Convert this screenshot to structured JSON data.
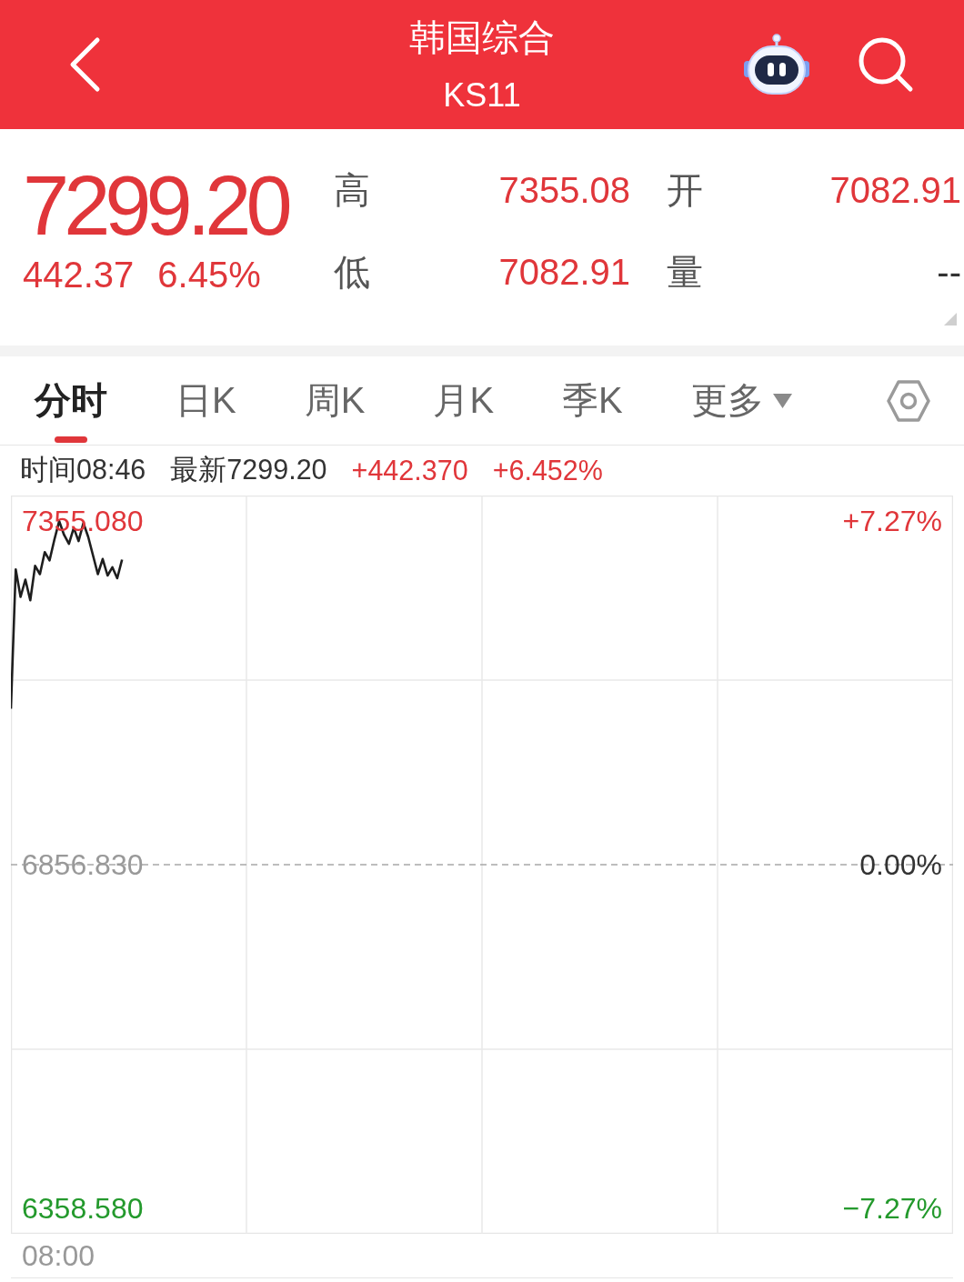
{
  "header": {
    "title": "韩国综合",
    "subtitle": "KS11"
  },
  "quote": {
    "price": "7299.20",
    "change": "442.37",
    "change_percent": "6.45%",
    "stats": [
      {
        "label": "高",
        "value": "7355.08",
        "color": "#e0363a"
      },
      {
        "label": "开",
        "value": "7082.91",
        "color": "#e0363a"
      },
      {
        "label": "低",
        "value": "7082.91",
        "color": "#e0363a"
      },
      {
        "label": "量",
        "value": "--",
        "color": "#333333"
      }
    ]
  },
  "tabs": [
    {
      "label": "分时",
      "selected": true,
      "kind": "tab"
    },
    {
      "label": "日K",
      "selected": false,
      "kind": "tab"
    },
    {
      "label": "周K",
      "selected": false,
      "kind": "tab"
    },
    {
      "label": "月K",
      "selected": false,
      "kind": "tab"
    },
    {
      "label": "季K",
      "selected": false,
      "kind": "tab"
    },
    {
      "label": "更多",
      "selected": false,
      "kind": "menu"
    }
  ],
  "info_bar": {
    "time": "时间08:46",
    "latest": "最新7299.20",
    "change": "+442.370",
    "change_percent": "+6.452%"
  },
  "chart": {
    "percent_labels": [
      {
        "text": "+7.27%",
        "color": "#e0363a"
      },
      {
        "text": "0.00%",
        "color": "#333333"
      },
      {
        "text": "−7.27%",
        "color": "#23992c"
      }
    ],
    "time_label": "08:00",
    "chart_data": {
      "type": "line",
      "categories": [
        null,
        null,
        null,
        null,
        null,
        null,
        null,
        null,
        null,
        null,
        null,
        null,
        null,
        null,
        null,
        null,
        null,
        null,
        null,
        null,
        null,
        null,
        null,
        null,
        null,
        null,
        null,
        null,
        null,
        null,
        null,
        null,
        null,
        null,
        null,
        null,
        null,
        null,
        null,
        null,
        null,
        null,
        null,
        null,
        null,
        null,
        null,
        null,
        null,
        null,
        null,
        null,
        null,
        null,
        null,
        null,
        null,
        null,
        null,
        null,
        null,
        null,
        null,
        null,
        null,
        null,
        null,
        null,
        null,
        null,
        null,
        null,
        null,
        null,
        null,
        null,
        null,
        null,
        null,
        null,
        null,
        null,
        null,
        null,
        null,
        null,
        null,
        null,
        null,
        null,
        null,
        null,
        null,
        null,
        null,
        null,
        null,
        null,
        null,
        null,
        null,
        null,
        null,
        null,
        null,
        null,
        null,
        null,
        null,
        null,
        null,
        null,
        null,
        null,
        null,
        null,
        null,
        null,
        null,
        null,
        null,
        null,
        null,
        null,
        null,
        null,
        null,
        null,
        null,
        null,
        null,
        null,
        null,
        null,
        null,
        null,
        null,
        null,
        null,
        null,
        null,
        null,
        null,
        null,
        null,
        null,
        null,
        null,
        null,
        null,
        null,
        null,
        null,
        null,
        null,
        null,
        null,
        null,
        null,
        null,
        null,
        null,
        null,
        null,
        null,
        null,
        null,
        null,
        null,
        null,
        null,
        null,
        null,
        null,
        null,
        null,
        null,
        null,
        null,
        null,
        null,
        null,
        null,
        null,
        null,
        null,
        null,
        null,
        null,
        null,
        null,
        null,
        null,
        null,
        null,
        null
      ],
      "values": [
        7083,
        7285,
        7245,
        7270,
        7240,
        7290,
        7278,
        7310,
        7298,
        7328,
        7355,
        7335,
        7322,
        7345,
        7326,
        7352,
        7332,
        7305,
        7278,
        7300,
        7276,
        7288,
        7272,
        7299,
        null,
        null,
        null,
        null,
        null,
        null,
        null,
        null,
        null,
        null,
        null,
        null,
        null,
        null,
        null,
        null,
        null,
        null,
        null,
        null,
        null,
        null,
        null,
        null,
        null,
        null,
        null,
        null,
        null,
        null,
        null,
        null,
        null,
        null,
        null,
        null,
        null,
        null,
        null,
        null,
        null,
        null,
        null,
        null,
        null,
        null,
        null,
        null,
        null,
        null,
        null,
        null,
        null,
        null,
        null,
        null,
        null,
        null,
        null,
        null,
        null,
        null,
        null,
        null,
        null,
        null,
        null,
        null,
        null,
        null,
        null,
        null,
        null,
        null,
        null,
        null,
        null,
        null,
        null,
        null,
        null,
        null,
        null,
        null,
        null,
        null,
        null,
        null,
        null,
        null,
        null,
        null,
        null,
        null,
        null,
        null,
        null,
        null,
        null,
        null,
        null,
        null,
        null,
        null,
        null,
        null,
        null,
        null,
        null,
        null,
        null,
        null,
        null,
        null,
        null,
        null,
        null,
        null,
        null,
        null,
        null,
        null,
        null,
        null,
        null,
        null,
        null,
        null,
        null,
        null,
        null,
        null,
        null,
        null,
        null,
        null,
        null,
        null,
        null,
        null,
        null,
        null,
        null,
        null,
        null,
        null,
        null,
        null,
        null,
        null,
        null,
        null,
        null,
        null,
        null,
        null,
        null,
        null,
        null,
        null,
        null,
        null,
        null,
        null,
        null,
        null,
        null,
        null,
        null,
        null,
        null,
        null
      ],
      "ylim": [
        6321.67,
        7391.99
      ],
      "yticks": [
        {
          "value": 7355.08,
          "label": "7355.080"
        },
        {
          "value": 6856.83,
          "label": "6856.830"
        },
        {
          "value": 6358.58,
          "label": "6358.580"
        }
      ],
      "ref_lines": [
        {
          "axis": "y",
          "value": 6856.83
        }
      ]
    }
  }
}
